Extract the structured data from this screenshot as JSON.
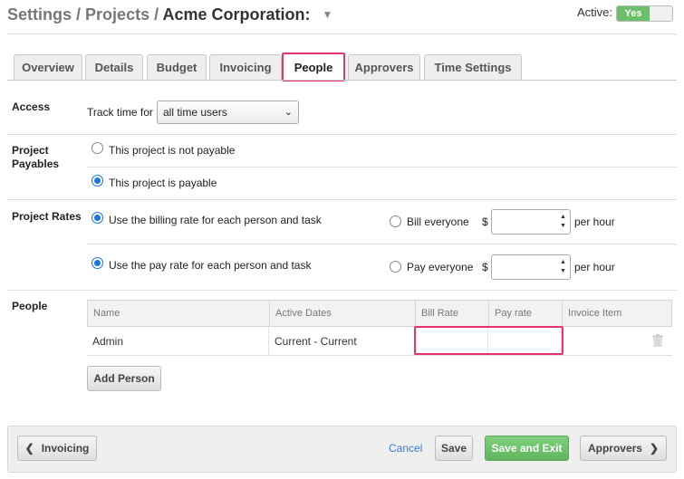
{
  "header": {
    "crumb_settings": "Settings",
    "crumb_projects": "Projects",
    "project_name": "Acme Corporation:",
    "active_label": "Active:",
    "active_toggle": "Yes"
  },
  "tabs": [
    {
      "label": "Overview"
    },
    {
      "label": "Details"
    },
    {
      "label": "Budget"
    },
    {
      "label": "Invoicing"
    },
    {
      "label": "People"
    },
    {
      "label": "Approvers"
    },
    {
      "label": "Time Settings"
    }
  ],
  "active_tab": "People",
  "access": {
    "label": "Access",
    "track_time_label": "Track time for",
    "track_time_value": "all time users"
  },
  "payables": {
    "label": "Project Payables",
    "option_not_payable": "This project is not payable",
    "option_payable": "This project is payable",
    "selected": "This project is payable"
  },
  "rates": {
    "label": "Project Rates",
    "billing_option": "Use the billing rate for each person and task",
    "pay_option": "Use the pay rate for each person and task",
    "bill_everyone": "Bill everyone",
    "pay_everyone": "Pay everyone",
    "currency": "$",
    "per_hour": "per hour",
    "bill_value": "",
    "pay_value": ""
  },
  "people": {
    "label": "People",
    "columns": [
      "Name",
      "Active Dates",
      "Bill Rate",
      "Pay rate",
      "Invoice Item"
    ],
    "rows": [
      {
        "name": "Admin",
        "active_dates": "Current - Current",
        "bill_rate": "",
        "pay_rate": "",
        "invoice_item": ""
      }
    ],
    "add_person": "Add Person"
  },
  "footer": {
    "back_label": "Invoicing",
    "cancel": "Cancel",
    "save": "Save",
    "save_exit": "Save and Exit",
    "next_label": "Approvers"
  },
  "colors": {
    "highlight": "#e8336b",
    "toggle_green": "#6cbf6a",
    "save_exit_green": "#5fb65c",
    "link_blue": "#3a7bd5",
    "radio_blue": "#1a73e8"
  }
}
